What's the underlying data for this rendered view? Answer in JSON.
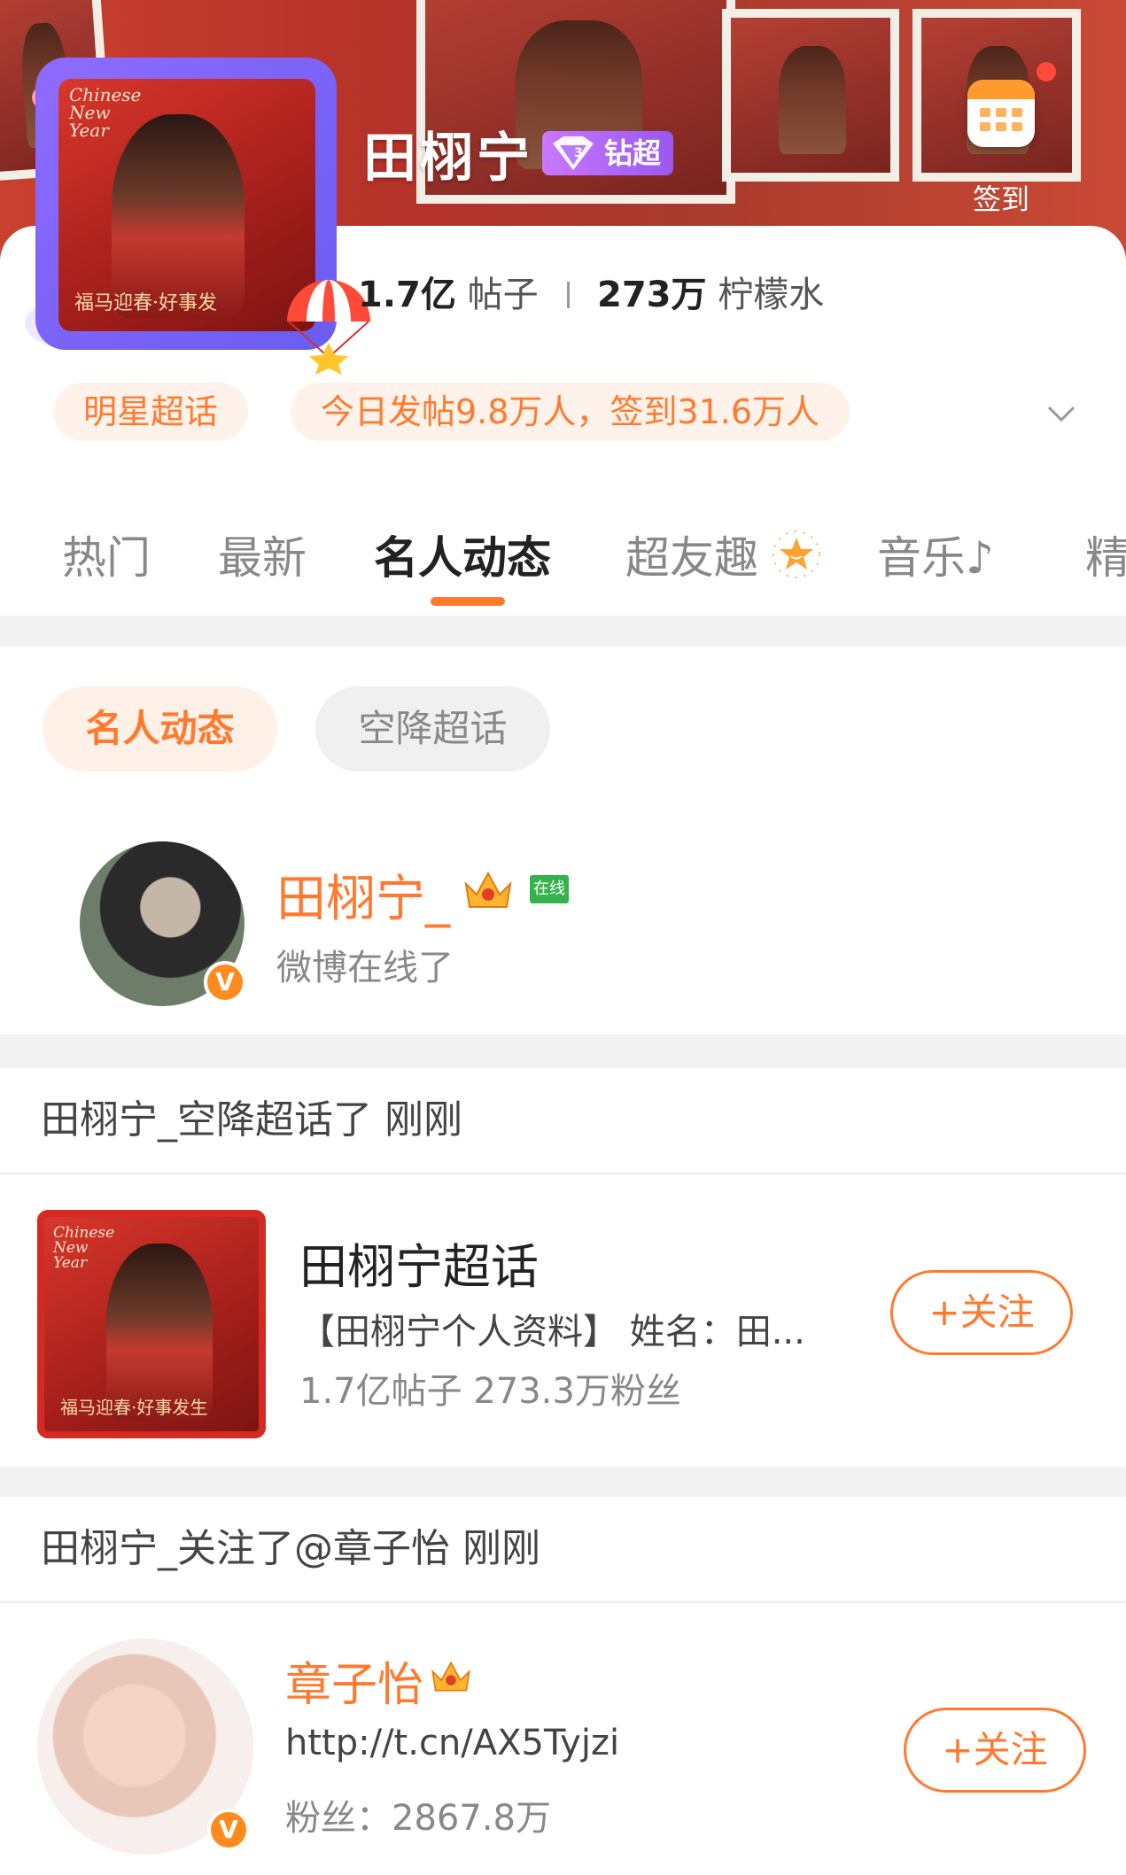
{
  "header": {
    "name": "田栩宁",
    "vip_label": "钻超",
    "checkin_label": "签到",
    "avatar_caption": "Chinese New Year",
    "avatar_slogan": "福马迎春·好事发",
    "stats": {
      "posts_value": "1.7亿",
      "posts_unit": "帖子",
      "fans_value": "273万",
      "fans_unit": "柠檬水"
    },
    "tags": {
      "category": "明星超话",
      "activity": "今日发帖9.8万人，签到31.6万人"
    }
  },
  "tabs": [
    {
      "label": "热门"
    },
    {
      "label": "最新"
    },
    {
      "label": "名人动态"
    },
    {
      "label": "超友趣"
    },
    {
      "label": "音乐♪"
    },
    {
      "label": "精"
    }
  ],
  "active_tab_index": 2,
  "filters": {
    "active": "名人动态",
    "inactive": "空降超话"
  },
  "online_user": {
    "name": "田栩宁_",
    "online_badge": "在线",
    "status": "微博在线了",
    "verified_mark": "V"
  },
  "activities": [
    {
      "header": "田栩宁_空降超话了 刚刚",
      "topic": {
        "title": "田栩宁超话",
        "description": "【田栩宁个人资料】 姓名：田...",
        "meta": "1.7亿帖子  273.3万粉丝",
        "image_caption": "Chinese New Year",
        "image_slogan": "福马迎春·好事发生",
        "follow_label": "+关注"
      }
    },
    {
      "header": "田栩宁_关注了@章子怡 刚刚",
      "person": {
        "name": "章子怡",
        "url": "http://t.cn/AX5Tyjzi",
        "fans": "粉丝：2867.8万",
        "verified_mark": "V",
        "follow_label": "+关注"
      }
    }
  ],
  "colors": {
    "accent": "#ff7a2f",
    "banner_red": "#b5322a",
    "vip_purple": "#9a58f0",
    "online_green": "#34b34a",
    "divider_gray": "#f2f2f2"
  },
  "icons": [
    "diamond-icon",
    "calendar-icon",
    "chevron-down-icon",
    "star-icon",
    "crown-icon",
    "verified-icon",
    "parachute-icon"
  ]
}
